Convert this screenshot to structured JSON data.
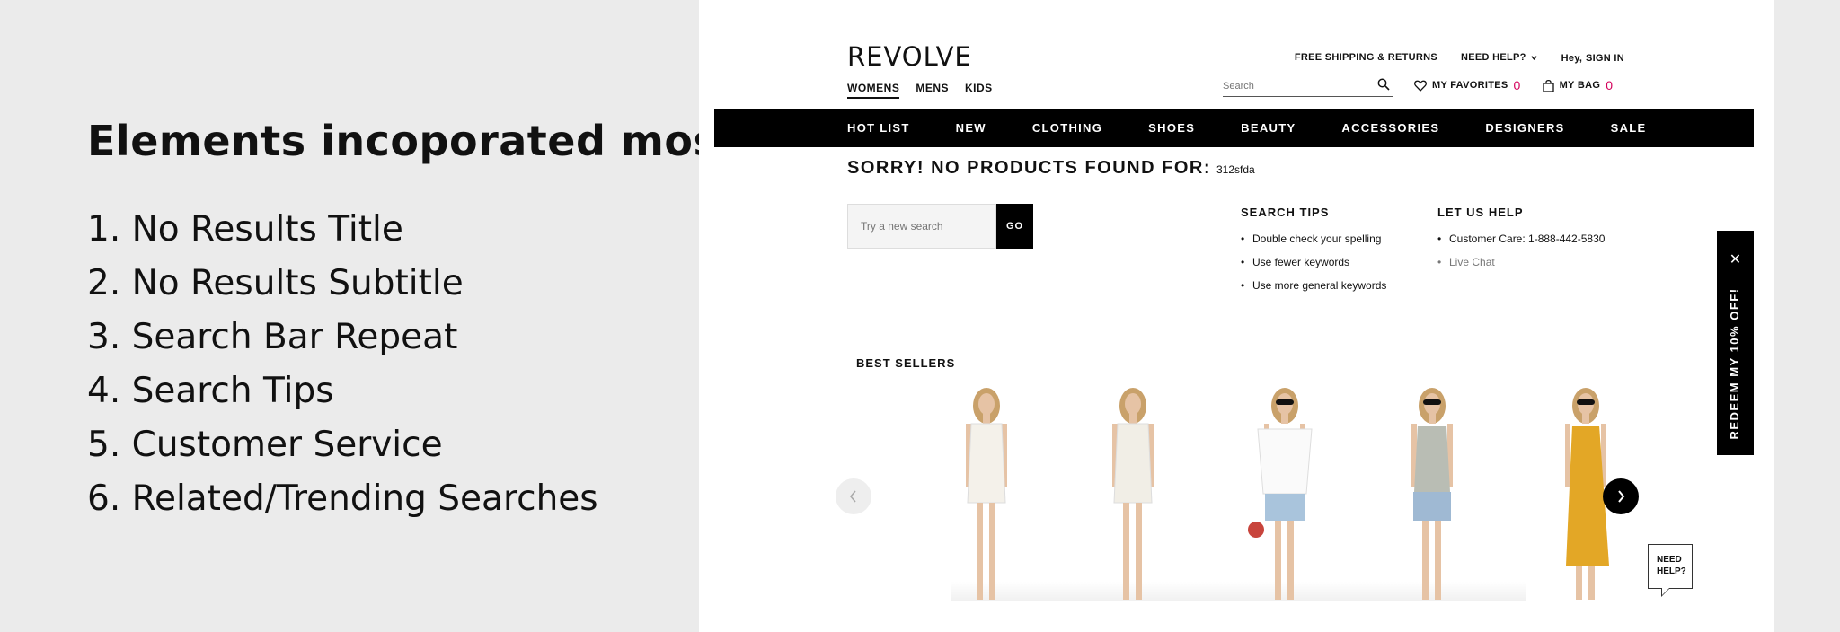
{
  "slide": {
    "title": "Elements incoporated most",
    "list": [
      "1. No Results Title",
      "2. No Results Subtitle",
      "3. Search Bar Repeat",
      "4. Search Tips",
      "5. Customer Service",
      "6. Related/Trending Searches"
    ]
  },
  "header": {
    "logo": "REVOLVE",
    "gender_tabs": [
      "WOMENS",
      "MENS",
      "KIDS"
    ],
    "free_shipping": "FREE SHIPPING & RETURNS",
    "need_help": "NEED HELP?",
    "greeting": "Hey,",
    "sign_in": "SIGN IN",
    "search_placeholder": "Search",
    "favorites_label": "MY FAVORITES",
    "favorites_count": "0",
    "bag_label": "MY BAG",
    "bag_count": "0"
  },
  "nav": [
    "HOT LIST",
    "NEW",
    "CLOTHING",
    "SHOES",
    "BEAUTY",
    "ACCESSORIES",
    "DESIGNERS",
    "SALE"
  ],
  "no_results": {
    "title": "SORRY! NO PRODUCTS FOUND FOR:",
    "query": "312sfda"
  },
  "retry_search": {
    "placeholder": "Try a new search",
    "button": "GO"
  },
  "search_tips": {
    "heading": "SEARCH TIPS",
    "items": [
      "Double check your spelling",
      "Use fewer keywords",
      "Use more general keywords"
    ]
  },
  "let_us_help": {
    "heading": "LET US HELP",
    "items": [
      "Customer Care: 1-888-442-5830",
      "Live Chat"
    ]
  },
  "best_sellers": {
    "heading": "BEST SELLERS",
    "products": [
      {
        "dress": "white mini dress",
        "color": "#f4f1ea"
      },
      {
        "dress": "white mini dress",
        "color": "#f1eee6"
      },
      {
        "dress": "white off-shoulder top",
        "color": "#fafafa"
      },
      {
        "dress": "grey camo tank",
        "color": "#b9bdb4"
      },
      {
        "dress": "yellow wrap dress",
        "color": "#e3a726"
      }
    ]
  },
  "promo": {
    "text": "REDEEM MY 10% OFF!"
  },
  "need_help_bubble": {
    "line1": "NEED",
    "line2": "HELP?"
  },
  "icons": {
    "search": "search-icon",
    "heart": "heart-icon",
    "bag": "bag-icon",
    "chevron": "chevron-down-icon",
    "close": "close-icon",
    "prev": "chevron-left-icon",
    "next": "chevron-right-icon"
  }
}
